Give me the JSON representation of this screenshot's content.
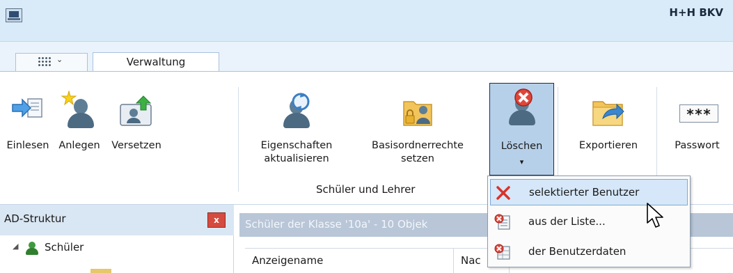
{
  "window": {
    "title": "H+H BKV"
  },
  "tabs": {
    "active_label": "Verwaltung"
  },
  "ribbon": {
    "buttons": [
      {
        "id": "einlesen",
        "label": "Einlesen",
        "icon": "import-arrow-icon"
      },
      {
        "id": "anlegen",
        "label": "Anlegen",
        "icon": "new-user-icon"
      },
      {
        "id": "versetzen",
        "label": "Versetzen",
        "icon": "move-user-icon"
      },
      {
        "id": "eigenschaften",
        "label_line1": "Eigenschaften",
        "label_line2": "aktualisieren",
        "icon": "refresh-user-icon"
      },
      {
        "id": "basisordner",
        "label_line1": "Basisordnerrechte",
        "label_line2": "setzen",
        "icon": "folder-lock-user-icon"
      },
      {
        "id": "loeschen",
        "label": "Löschen",
        "icon": "delete-user-icon",
        "dropdown_caret": "▾"
      },
      {
        "id": "exportieren",
        "label": "Exportieren",
        "icon": "export-folder-icon"
      },
      {
        "id": "passwort",
        "label": "Passwort",
        "icon": "password-icon",
        "icon_text": "***"
      }
    ],
    "group_label": "Schüler und Lehrer"
  },
  "dropdown_menu": {
    "items": [
      {
        "label": "selektierter Benutzer",
        "icon": "red-x-icon",
        "highlighted": true
      },
      {
        "label": "aus der Liste...",
        "icon": "delete-list-icon",
        "highlighted": false
      },
      {
        "label": "der Benutzerdaten",
        "icon": "delete-data-icon",
        "highlighted": false
      }
    ]
  },
  "left_panel": {
    "title": "AD-Struktur",
    "close_glyph": "x",
    "tree": [
      {
        "label": "Schüler",
        "expanded_glyph": "◢"
      }
    ]
  },
  "content": {
    "title": "Schüler der Klasse '10a' - 10 Objek",
    "columns": [
      {
        "label": "Anzeigename"
      },
      {
        "label": "Nac"
      }
    ]
  },
  "colors": {
    "titlebar": "#d9eaf8",
    "selected_button": "#b7d0e9",
    "menu_highlight": "#d5e7f8",
    "delete_red": "#d9322a"
  }
}
